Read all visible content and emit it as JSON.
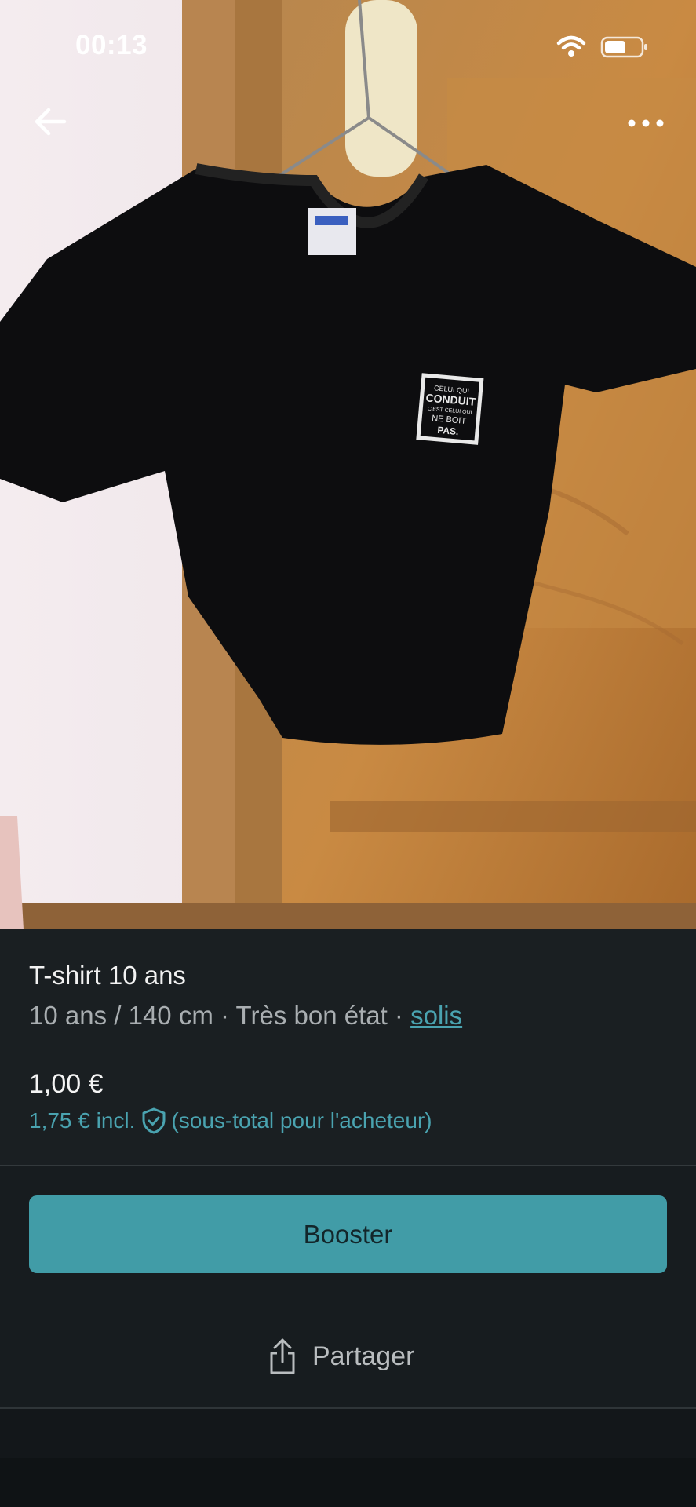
{
  "status_bar": {
    "time": "00:13",
    "wifi_icon": "wifi-icon",
    "battery_icon": "battery-icon"
  },
  "nav": {
    "back_icon": "arrow-left-icon",
    "more_icon": "more-horizontal-icon"
  },
  "photo": {
    "description_icon": "product-photo",
    "logo_text": [
      "CELUI QUI",
      "CONDUIT",
      "C'EST CELUI QUI",
      "NE BOIT",
      "PAS."
    ]
  },
  "item": {
    "title": "T-shirt 10 ans",
    "size": "10 ans / 140 cm",
    "separator1": " · ",
    "condition": "Très bon état",
    "separator2": " · ",
    "brand": "solis"
  },
  "pricing": {
    "price": "1,00 €",
    "price_incl": "1,75 € incl.",
    "protection_icon": "shield-check-icon",
    "buyer_note": "(sous-total pour l'acheteur)"
  },
  "actions": {
    "booster_label": "Booster",
    "share_label": "Partager",
    "share_icon": "share-icon"
  },
  "colors": {
    "accent": "#419ca7",
    "link": "#4aa3b0",
    "background": "#171c1f"
  }
}
